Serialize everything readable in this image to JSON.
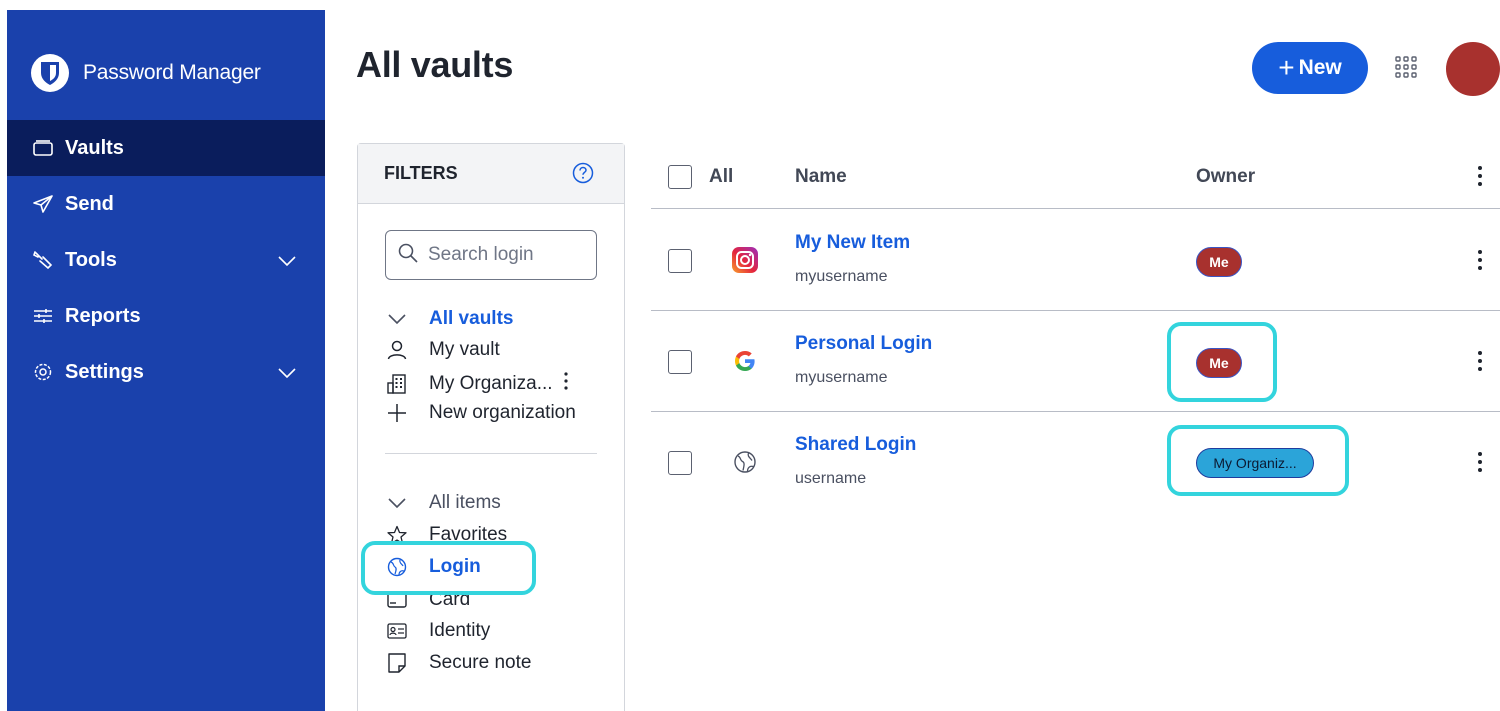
{
  "app": {
    "brand": "Password Manager",
    "colors": {
      "sidebar": "#1a41ac",
      "sidebar_active": "#0a1d5c",
      "primary": "#175ddc",
      "avatar": "#a8312e",
      "highlight": "#33d4dd",
      "badge_me": "#a8312e",
      "badge_org": "#2ba4d9"
    }
  },
  "sidebar": {
    "items": [
      {
        "label": "Vaults",
        "icon": "vault-icon",
        "active": true
      },
      {
        "label": "Send",
        "icon": "send-icon"
      },
      {
        "label": "Tools",
        "icon": "wrench-icon",
        "expandable": true
      },
      {
        "label": "Reports",
        "icon": "sliders-icon"
      },
      {
        "label": "Settings",
        "icon": "gear-icon",
        "expandable": true
      }
    ]
  },
  "header": {
    "title": "All vaults",
    "new_label": "New"
  },
  "filters": {
    "title": "FILTERS",
    "search_placeholder": "Search login",
    "vaults": {
      "all": "All vaults",
      "my_vault": "My vault",
      "org": "My Organiza...",
      "new_org": "New organization"
    },
    "types": {
      "all": "All items",
      "favorites": "Favorites",
      "login": "Login",
      "card": "Card",
      "identity": "Identity",
      "secure_note": "Secure note"
    }
  },
  "table": {
    "headers": {
      "all": "All",
      "name": "Name",
      "owner": "Owner"
    },
    "rows": [
      {
        "name": "My New Item",
        "username": "myusername",
        "owner": "Me",
        "icon": "instagram-icon"
      },
      {
        "name": "Personal Login",
        "username": "myusername",
        "owner": "Me",
        "icon": "google-icon"
      },
      {
        "name": "Shared Login",
        "username": "username",
        "owner": "My Organiz...",
        "icon": "globe-icon"
      }
    ]
  }
}
